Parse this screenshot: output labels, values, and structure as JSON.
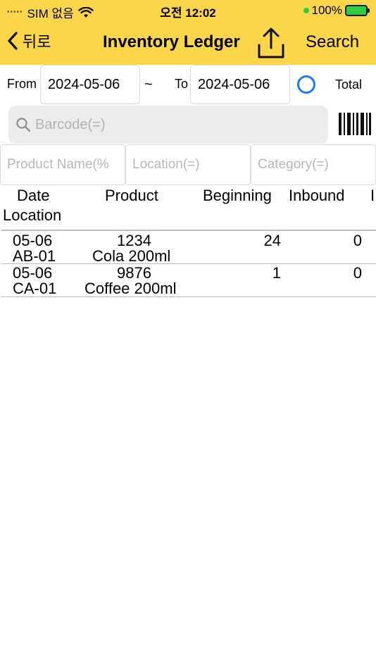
{
  "status": {
    "carrier": "SIM 없음",
    "time": "오전 12:02",
    "battery": "100%"
  },
  "nav": {
    "back_label": "뒤로",
    "title": "Inventory Ledger",
    "search_label": "Search"
  },
  "dates": {
    "from_label": "From",
    "from_value": "2024-05-06",
    "separator": "~",
    "to_label": "To",
    "to_value": "2024-05-06",
    "total_label": "Total"
  },
  "barcode": {
    "placeholder": "Barcode(=)"
  },
  "filters": {
    "product_placeholder": "Product Name(%",
    "location_placeholder": "Location(=)",
    "category_placeholder": "Category(=)"
  },
  "table": {
    "headers": {
      "date": "Date",
      "location": "Location",
      "product": "Product",
      "beginning": "Beginning",
      "inbound": "Inbound",
      "overflow": "I"
    },
    "rows": [
      {
        "date": "05-06",
        "location": "AB-01",
        "code": "1234",
        "name": "Cola 200ml",
        "beginning": "24",
        "inbound": "0"
      },
      {
        "date": "05-06",
        "location": "CA-01",
        "code": "9876",
        "name": "Coffee 200ml",
        "beginning": "1",
        "inbound": "0"
      }
    ]
  },
  "colors": {
    "header_bg": "#fbd54a",
    "radio": "#1a7cf5",
    "battery": "#2ecc40"
  }
}
